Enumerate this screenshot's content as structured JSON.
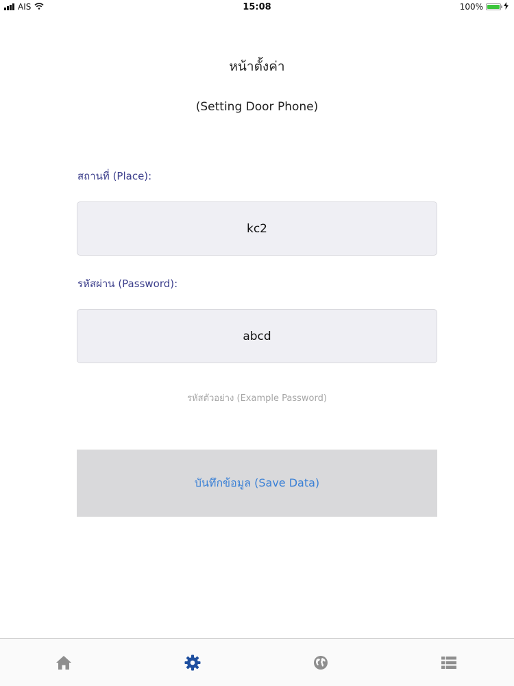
{
  "status_bar": {
    "carrier": "AIS",
    "time": "15:08",
    "battery_percent": "100%",
    "battery_level": 1.0
  },
  "page": {
    "title": "หน้าตั้งค่า",
    "subtitle": "(Setting Door Phone)"
  },
  "form": {
    "place_label": "สถานที่ (Place):",
    "place_value": "kc2",
    "password_label": "รหัสผ่าน (Password):",
    "password_value": "abcd",
    "hint": "รหัสตัวอย่าง (Example Password)",
    "save_label": "บันทึกข้อมูล (Save Data)"
  },
  "tab_bar": {
    "items": [
      {
        "icon": "home-icon",
        "active": false
      },
      {
        "icon": "gear-icon",
        "active": true
      },
      {
        "icon": "globe-icon",
        "active": false
      },
      {
        "icon": "list-icon",
        "active": false
      }
    ]
  },
  "colors": {
    "label": "#3c3f8c",
    "button_text": "#3a80d6",
    "active_tab": "#1f4f9f",
    "inactive_tab": "#8e8e8e"
  }
}
